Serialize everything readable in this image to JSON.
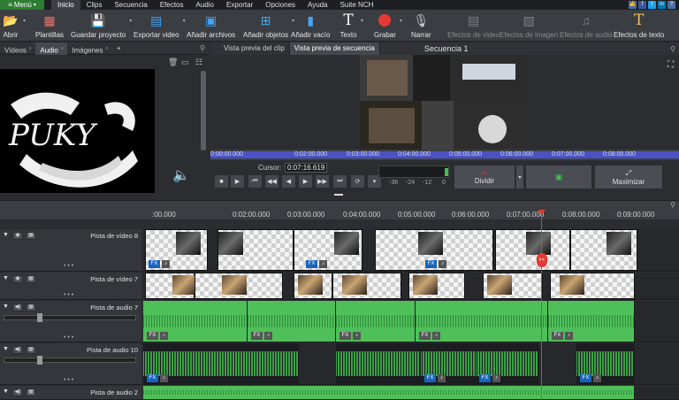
{
  "menubar": {
    "menu_label": "Menú",
    "items": [
      "Inicio",
      "Clips",
      "Secuencia",
      "Efectos",
      "Audio",
      "Exportar",
      "Opciones",
      "Ayuda",
      "Suite NCH"
    ]
  },
  "toolbar": {
    "abrir": "Abrir",
    "plantillas": "Plantillas",
    "guardar_proyecto": "Guardar proyecto",
    "exportar_video": "Exportar video",
    "anadir_archivos": "Añadir archivos",
    "anadir_objetos": "Añadir objetos",
    "anadir_vacio": "Añadir vacío",
    "texto": "Texto",
    "grabar": "Grabar",
    "narrar": "Narrar",
    "efectos_video": "Efectos de video",
    "efectos_imagen": "Efectos de imagen",
    "efectos_audio": "Efectos de audio",
    "efectos_texto": "Efectos de texto"
  },
  "bin": {
    "tabs": [
      "Vídeos",
      "Audio",
      "Imágenes",
      "+"
    ],
    "thumbnail_text": "PUKY"
  },
  "preview": {
    "tab_clip": "Vista previa del clip",
    "tab_seq": "Vista previa de secuencia",
    "title": "Secuencia 1",
    "scrub_ticks": [
      "0:00:00.000",
      "0:02:00.000",
      "0:03:00.000",
      "0:04:00.000",
      "0:05:00.000",
      "0:06:00.000",
      "0:07:00.000",
      "0:08:00.000"
    ],
    "cursor_label": "Cursor:",
    "cursor_value": "0:07:16.619",
    "vu_labels": [
      "-36",
      "-24",
      "-12",
      "0"
    ],
    "dividir": "Dividir",
    "maximizar": "Maximizar"
  },
  "timeline": {
    "ruler_ticks": [
      ":00.000",
      "0:02:00.000",
      "0:03:00.000",
      "0:04:00.000",
      "0:05:00.000",
      "0:06:00.000",
      "0:07:00.000",
      "0:08:00.000",
      "0:09:00.000"
    ],
    "tracks": [
      {
        "name": "Pista de vídeo 8"
      },
      {
        "name": "Pista de vídeo 7"
      },
      {
        "name": "Pista de audio 7"
      },
      {
        "name": "Pista de audio 10"
      },
      {
        "name": "Pista de audio 2"
      }
    ],
    "fx_label": "FX"
  }
}
